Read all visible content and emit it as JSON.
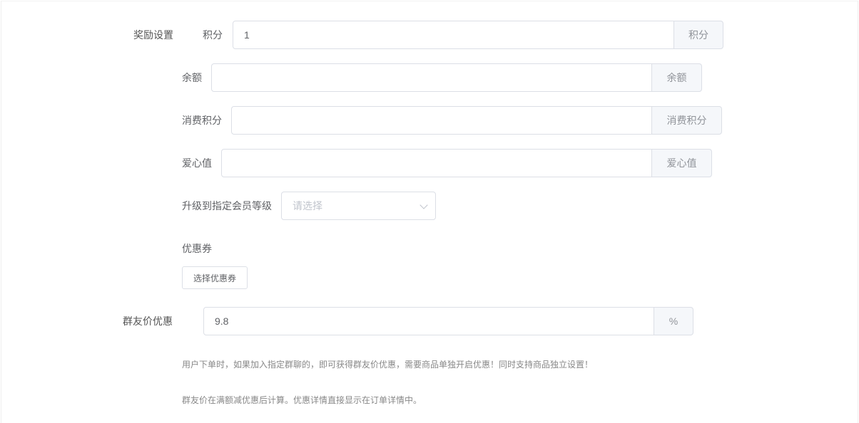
{
  "reward": {
    "section_label": "奖励设置",
    "points": {
      "label": "积分",
      "value": "1",
      "append": "积分"
    },
    "balance": {
      "label": "余额",
      "value": "",
      "append": "余额"
    },
    "consume_points": {
      "label": "消费积分",
      "value": "",
      "append": "消费积分"
    },
    "love_value": {
      "label": "爱心值",
      "value": "",
      "append": "爱心值"
    },
    "upgrade_level": {
      "label": "升级到指定会员等级",
      "placeholder": "请选择"
    },
    "coupon": {
      "label": "优惠券",
      "button": "选择优惠券"
    }
  },
  "group_price": {
    "label": "群友价优惠",
    "value": "9.8",
    "append": "%",
    "help1": "用户下单时，如果加入指定群聊的，即可获得群友价优惠，需要商品单独开启优惠！同时支持商品独立设置！",
    "help2": "群友价在满额减优惠后计算。优惠详情直接显示在订单详情中。"
  }
}
